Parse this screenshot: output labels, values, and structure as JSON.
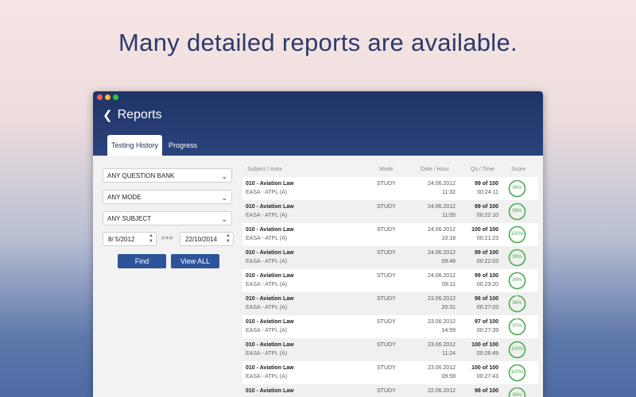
{
  "headline": "Many detailed reports are available.",
  "window": {
    "title": "Reports",
    "tabs": [
      {
        "label": "Testing History",
        "active": true
      },
      {
        "label": "Progress",
        "active": false
      }
    ]
  },
  "filters": {
    "question_bank": "ANY QUESTION BANK",
    "mode": "ANY MODE",
    "subject": "ANY SUBJECT",
    "date_from": "8/ 5/2012",
    "date_separator": ">>>",
    "date_to": "22/10/2014",
    "find_label": "Find",
    "view_all_label": "View ALL"
  },
  "table": {
    "headers": {
      "subject": "Subject / Area",
      "mode": "Mode",
      "date": "Date / Hour",
      "qs": "Qs / Time",
      "score": "Score"
    },
    "rows": [
      {
        "subject": "010 - Aviation Law",
        "area": "EASA - ATPL (A)",
        "mode": "STUDY",
        "date": "24.06.2012",
        "hour": "11:32",
        "qs": "99 of 100",
        "time": "00:24:11",
        "score": "99%",
        "score_value": 99
      },
      {
        "subject": "010 - Aviation Law",
        "area": "EASA - ATPL (A)",
        "mode": "STUDY",
        "date": "24.06.2012",
        "hour": "11:05",
        "qs": "99 of 100",
        "time": "00:22:10",
        "score": "99%",
        "score_value": 99
      },
      {
        "subject": "010 - Aviation Law",
        "area": "EASA - ATPL (A)",
        "mode": "STUDY",
        "date": "24.06.2012",
        "hour": "10:18",
        "qs": "100 of 100",
        "time": "00:21:23",
        "score": "100%",
        "score_value": 100
      },
      {
        "subject": "010 - Aviation Law",
        "area": "EASA - ATPL (A)",
        "mode": "STUDY",
        "date": "24.06.2012",
        "hour": "09:48",
        "qs": "99 of 100",
        "time": "00:22:03",
        "score": "99%",
        "score_value": 99
      },
      {
        "subject": "010 - Aviation Law",
        "area": "EASA - ATPL (A)",
        "mode": "STUDY",
        "date": "24.06.2012",
        "hour": "09:11",
        "qs": "99 of 100",
        "time": "00:23:20",
        "score": "99%",
        "score_value": 99
      },
      {
        "subject": "010 - Aviation Law",
        "area": "EASA - ATPL (A)",
        "mode": "STUDY",
        "date": "23.06.2012",
        "hour": "20:31",
        "qs": "96 of 100",
        "time": "00:27:03",
        "score": "96%",
        "score_value": 96
      },
      {
        "subject": "010 - Aviation Law",
        "area": "EASA - ATPL (A)",
        "mode": "STUDY",
        "date": "23.06.2012",
        "hour": "14:59",
        "qs": "97 of 100",
        "time": "00:27:39",
        "score": "97%",
        "score_value": 97
      },
      {
        "subject": "010 - Aviation Law",
        "area": "EASA - ATPL (A)",
        "mode": "STUDY",
        "date": "23.06.2012",
        "hour": "11:24",
        "qs": "100 of 100",
        "time": "00:26:49",
        "score": "100%",
        "score_value": 100
      },
      {
        "subject": "010 - Aviation Law",
        "area": "EASA - ATPL (A)",
        "mode": "STUDY",
        "date": "23.06.2012",
        "hour": "09:59",
        "qs": "100 of 100",
        "time": "00:27:43",
        "score": "100%",
        "score_value": 100
      },
      {
        "subject": "010 - Aviation Law",
        "area": "EASA - ATPL (A)",
        "mode": "STUDY",
        "date": "22.06.2012",
        "hour": "",
        "qs": "98 of 100",
        "time": "",
        "score": "98%",
        "score_value": 98
      }
    ]
  },
  "colors": {
    "score_ring": "#4caf50",
    "score_track": "#dcdcdc"
  }
}
